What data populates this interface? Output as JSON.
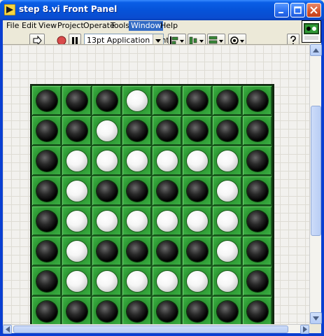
{
  "window": {
    "title": "step 8.vi Front Panel"
  },
  "menu": [
    {
      "label": "File"
    },
    {
      "label": "Edit"
    },
    {
      "label": "View"
    },
    {
      "label": "Project"
    },
    {
      "label": "Operate"
    },
    {
      "label": "Tools"
    },
    {
      "label": "Window",
      "active": true
    },
    {
      "label": "Help"
    }
  ],
  "toolbar": {
    "font_select": "13pt Application Font",
    "tools": [
      "run-arrow-icon",
      "abort-icon",
      "pause-icon",
      "align-icon",
      "distribute-icon",
      "resize-icon",
      "reorder-icon",
      "help-icon"
    ]
  },
  "board": {
    "rows": [
      [
        "black",
        "black",
        "black",
        "white",
        "black",
        "black",
        "black",
        "black"
      ],
      [
        "black",
        "black",
        "white",
        "black",
        "black",
        "black",
        "black",
        "black"
      ],
      [
        "black",
        "white",
        "white",
        "white",
        "white",
        "white",
        "white",
        "black"
      ],
      [
        "black",
        "white",
        "black",
        "black",
        "black",
        "black",
        "white",
        "black"
      ],
      [
        "black",
        "white",
        "white",
        "white",
        "white",
        "white",
        "white",
        "black"
      ],
      [
        "black",
        "white",
        "black",
        "black",
        "black",
        "black",
        "white",
        "black"
      ],
      [
        "black",
        "white",
        "white",
        "white",
        "white",
        "white",
        "white",
        "black"
      ],
      [
        "black",
        "black",
        "black",
        "black",
        "black",
        "black",
        "black",
        "black"
      ]
    ],
    "colors": {
      "board_green": "#2f9a35",
      "black_piece": "#000000",
      "white_piece": "#ffffff"
    }
  }
}
